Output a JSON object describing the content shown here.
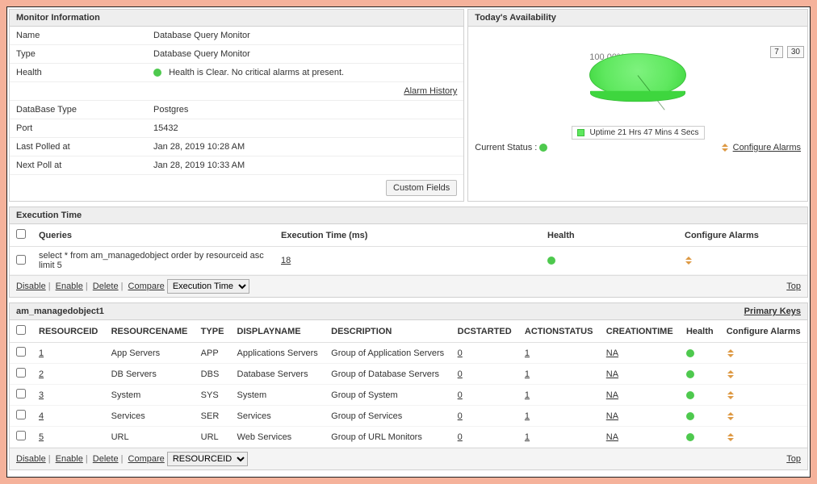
{
  "monitorInfo": {
    "title": "Monitor Information",
    "rows": {
      "name_label": "Name",
      "name_value": "Database Query Monitor",
      "type_label": "Type",
      "type_value": "Database Query Monitor",
      "health_label": "Health",
      "health_value": "Health is Clear. No critical alarms at present.",
      "alarm_history": "Alarm History",
      "dbtype_label": "DataBase Type",
      "dbtype_value": "Postgres",
      "port_label": "Port",
      "port_value": "15432",
      "lastpoll_label": "Last Polled at",
      "lastpoll_value": "Jan 28, 2019 10:28 AM",
      "nextpoll_label": "Next Poll at",
      "nextpoll_value": "Jan 28, 2019 10:33 AM"
    },
    "custom_fields_btn": "Custom Fields"
  },
  "availability": {
    "title": "Today's Availability",
    "percent_label": "100.00%",
    "btn7": "7",
    "btn30": "30",
    "legend_text": "Uptime 21 Hrs 47 Mins 4 Secs",
    "current_status_label": "Current Status :",
    "configure_alarms": "Configure Alarms"
  },
  "execTime": {
    "title": "Execution Time",
    "cols": {
      "queries": "Queries",
      "exec": "Execution Time (ms)",
      "health": "Health",
      "config": "Configure Alarms"
    },
    "row": {
      "query": "select * from am_managedobject order by resourceid asc limit 5",
      "ms": "18"
    },
    "select_value": "Execution Time",
    "actions": {
      "disable": "Disable",
      "enable": "Enable",
      "delete": "Delete",
      "compare": "Compare",
      "top": "Top"
    }
  },
  "managed": {
    "title": "am_managedobject1",
    "primary_keys": "Primary Keys",
    "cols": {
      "rid": "RESOURCEID",
      "rname": "RESOURCENAME",
      "type": "TYPE",
      "dname": "DISPLAYNAME",
      "desc": "DESCRIPTION",
      "dcs": "DCSTARTED",
      "act": "ACTIONSTATUS",
      "ct": "CREATIONTIME",
      "health": "Health",
      "config": "Configure Alarms"
    },
    "rows": [
      {
        "id": "1",
        "rname": "App Servers",
        "type": "APP",
        "dname": "Applications Servers",
        "desc": "Group of Application Servers",
        "dcs": "0",
        "act": "1",
        "ct": "NA"
      },
      {
        "id": "2",
        "rname": "DB Servers",
        "type": "DBS",
        "dname": "Database Servers",
        "desc": "Group of Database Servers",
        "dcs": "0",
        "act": "1",
        "ct": "NA"
      },
      {
        "id": "3",
        "rname": "System",
        "type": "SYS",
        "dname": "System",
        "desc": "Group of System",
        "dcs": "0",
        "act": "1",
        "ct": "NA"
      },
      {
        "id": "4",
        "rname": "Services",
        "type": "SER",
        "dname": "Services",
        "desc": "Group of Services",
        "dcs": "0",
        "act": "1",
        "ct": "NA"
      },
      {
        "id": "5",
        "rname": "URL",
        "type": "URL",
        "dname": "Web Services",
        "desc": "Group of URL Monitors",
        "dcs": "0",
        "act": "1",
        "ct": "NA"
      }
    ],
    "select_value": "RESOURCEID",
    "actions": {
      "disable": "Disable",
      "enable": "Enable",
      "delete": "Delete",
      "compare": "Compare",
      "top": "Top"
    }
  },
  "chart_data": {
    "type": "pie",
    "title": "Today's Availability",
    "series": [
      {
        "name": "Uptime 21 Hrs 47 Mins 4 Secs",
        "values": [
          100.0
        ]
      }
    ],
    "categories": [
      "Uptime"
    ],
    "percent": 100.0
  }
}
